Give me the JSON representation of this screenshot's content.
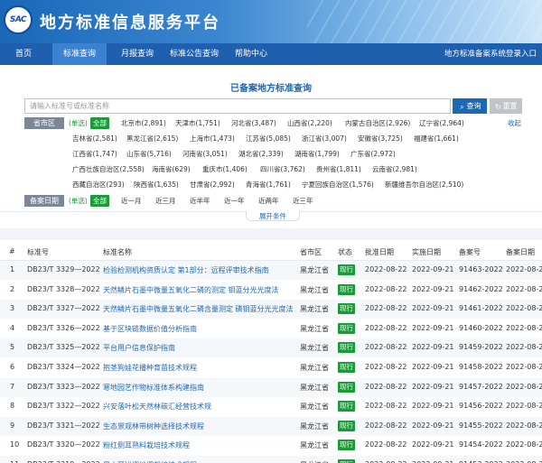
{
  "header": {
    "logo_text": "SAC",
    "title": "地方标准信息服务平台"
  },
  "nav": {
    "items": [
      "首页",
      "标准查询",
      "月报查询",
      "标准公告查询",
      "帮助中心"
    ],
    "active_index": 1,
    "right_link": "地方标准备案系统登录入口"
  },
  "page_title": "已备案地方标准查询",
  "search": {
    "placeholder": "请输入标准号或标准名称",
    "value": "",
    "search_label": "查询",
    "reset_label": "重置"
  },
  "region_filter": {
    "label": "省市区",
    "single_label": "(单选)",
    "all_label": "全部",
    "collapse_label": "收起",
    "regions": [
      "北京市(2,891)",
      "天津市(1,751)",
      "河北省(3,487)",
      "山西省(2,220)",
      "内蒙古自治区(2,926)",
      "辽宁省(2,964)",
      "吉林省(2,581)",
      "黑龙江省(2,615)",
      "上海市(1,473)",
      "江苏省(5,085)",
      "浙江省(3,007)",
      "安徽省(3,725)",
      "福建省(1,661)",
      "江西省(1,747)",
      "山东省(5,716)",
      "河南省(3,051)",
      "湖北省(2,339)",
      "湖南省(1,799)",
      "广东省(2,972)",
      "广西壮族自治区(2,558)",
      "海南省(629)",
      "重庆市(1,406)",
      "四川省(3,762)",
      "贵州省(1,811)",
      "云南省(2,981)",
      "西藏自治区(293)",
      "陕西省(1,635)",
      "甘肃省(2,992)",
      "青海省(1,761)",
      "宁夏回族自治区(1,576)",
      "新疆维吾尔自治区(2,510)"
    ]
  },
  "date_filter": {
    "label": "备案日期",
    "single_label": "(单选)",
    "all_label": "全部",
    "options": [
      "近一月",
      "近三月",
      "近半年",
      "近一年",
      "近两年",
      "近三年"
    ]
  },
  "expand_label": "展开条件",
  "table": {
    "headers": [
      "#",
      "标准号",
      "标准名称",
      "省市区",
      "状态",
      "批准日期",
      "实施日期",
      "备案号",
      "备案日期"
    ],
    "rows": [
      {
        "n": "1",
        "code": "DB23/T 3329—2022",
        "name": "检验检测机构资质认定 第1部分：远程评审技术指南",
        "region": "黑龙江省",
        "status": "现行",
        "approve": "2022-08-22",
        "implement": "2022-09-21",
        "record_no": "91463-2022",
        "record_date": "2022-08-26"
      },
      {
        "n": "2",
        "code": "DB23/T 3328—2022",
        "name": "天然鳞片石墨中微量五氧化二磷的测定 钼蓝分光光度法",
        "region": "黑龙江省",
        "status": "现行",
        "approve": "2022-08-22",
        "implement": "2022-09-21",
        "record_no": "91462-2022",
        "record_date": "2022-08-26"
      },
      {
        "n": "3",
        "code": "DB23/T 3327—2022",
        "name": "天然鳞片石墨中微量五氧化二磷含量测定 磷钼蓝分光光度法",
        "region": "黑龙江省",
        "status": "现行",
        "approve": "2022-08-22",
        "implement": "2022-09-21",
        "record_no": "91461-2022",
        "record_date": "2022-08-26"
      },
      {
        "n": "4",
        "code": "DB23/T 3326—2022",
        "name": "基于区块链数据价值分析指南",
        "region": "黑龙江省",
        "status": "现行",
        "approve": "2022-08-22",
        "implement": "2022-09-21",
        "record_no": "91460-2022",
        "record_date": "2022-08-26"
      },
      {
        "n": "5",
        "code": "DB23/T 3325—2022",
        "name": "平台用户信息保护指南",
        "region": "黑龙江省",
        "status": "现行",
        "approve": "2022-08-22",
        "implement": "2022-09-21",
        "record_no": "91459-2022",
        "record_date": "2022-08-26"
      },
      {
        "n": "6",
        "code": "DB23/T 3324—2022",
        "name": "抱茎狗娃花播种育苗技术规程",
        "region": "黑龙江省",
        "status": "现行",
        "approve": "2022-08-22",
        "implement": "2022-09-21",
        "record_no": "91458-2022",
        "record_date": "2022-08-26"
      },
      {
        "n": "7",
        "code": "DB23/T 3323—2022",
        "name": "寒地园艺作物标准体系构建指南",
        "region": "黑龙江省",
        "status": "现行",
        "approve": "2022-08-22",
        "implement": "2022-09-21",
        "record_no": "91457-2022",
        "record_date": "2022-08-26"
      },
      {
        "n": "8",
        "code": "DB23/T 3322—2022",
        "name": "兴安落叶松天然林碳汇经营技术规",
        "region": "黑龙江省",
        "status": "现行",
        "approve": "2022-08-22",
        "implement": "2022-09-21",
        "record_no": "91456-2022",
        "record_date": "2022-08-26"
      },
      {
        "n": "9",
        "code": "DB23/T 3321—2022",
        "name": "生态景观林带树种选择技术规程",
        "region": "黑龙江省",
        "status": "现行",
        "approve": "2022-08-22",
        "implement": "2022-09-21",
        "record_no": "91455-2022",
        "record_date": "2022-08-26"
      },
      {
        "n": "10",
        "code": "DB23/T 3320—2022",
        "name": "粉红侧耳熟料栽培技术规程",
        "region": "黑龙江省",
        "status": "现行",
        "approve": "2022-08-22",
        "implement": "2022-09-21",
        "record_no": "91454-2022",
        "record_date": "2022-08-26"
      },
      {
        "n": "11",
        "code": "DB23/T 3319—2022",
        "name": "黑木耳拱棚地摆栽培技术规程",
        "region": "黑龙江省",
        "status": "现行",
        "approve": "2022-08-22",
        "implement": "2022-09-21",
        "record_no": "91453-2022",
        "record_date": "2022-08-26"
      }
    ]
  },
  "watermark": "知乎 @野猫行天下",
  "colors": {
    "brand_blue": "#1e5fae",
    "link_blue": "#1d68b5",
    "status_green": "#1c9a3a"
  }
}
